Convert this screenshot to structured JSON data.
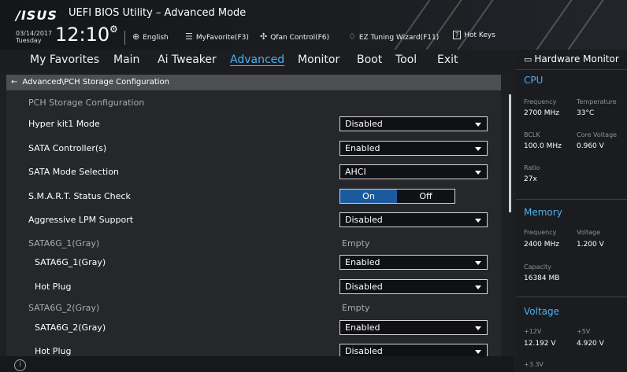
{
  "header": {
    "logo": "/ISUS",
    "title": "UEFI BIOS Utility – Advanced Mode",
    "date": "03/14/2017",
    "day": "Tuesday",
    "time": "12:10",
    "tools": [
      {
        "icon": "globe-icon",
        "label": "English"
      },
      {
        "icon": "favorite-icon",
        "label": "MyFavorite(F3)"
      },
      {
        "icon": "fan-icon",
        "label": "Qfan Control(F6)"
      },
      {
        "icon": "bulb-icon",
        "label": "EZ Tuning Wizard(F11)"
      },
      {
        "icon": "hotkeys-icon",
        "label": "Hot Keys"
      }
    ]
  },
  "nav": {
    "tabs": [
      "My Favorites",
      "Main",
      "Ai Tweaker",
      "Advanced",
      "Monitor",
      "Boot",
      "Tool",
      "Exit"
    ],
    "active": "Advanced"
  },
  "breadcrumb": "Advanced\\PCH Storage Configuration",
  "main": {
    "section_title": "PCH Storage Configuration",
    "rows": [
      {
        "label": "Hyper kit1 Mode",
        "value": "Disabled"
      },
      {
        "label": "SATA Controller(s)",
        "value": "Enabled"
      },
      {
        "label": "SATA Mode Selection",
        "value": "AHCI"
      },
      {
        "label": "S.M.A.R.T. Status Check",
        "on": "On",
        "off": "Off"
      },
      {
        "label": "Aggressive LPM Support",
        "value": "Disabled"
      },
      {
        "label": "SATA6G_1(Gray)",
        "value": "Empty"
      },
      {
        "label": "SATA6G_1(Gray)",
        "value": "Enabled"
      },
      {
        "label": "Hot Plug",
        "value": "Disabled"
      },
      {
        "label": "SATA6G_2(Gray)",
        "value": "Empty"
      },
      {
        "label": "SATA6G_2(Gray)",
        "value": "Enabled"
      },
      {
        "label": "Hot Plug",
        "value": "Disabled"
      }
    ]
  },
  "hw_monitor": {
    "title": "Hardware Monitor",
    "cpu": {
      "heading": "CPU",
      "frequency_label": "Frequency",
      "frequency": "2700 MHz",
      "temperature_label": "Temperature",
      "temperature": "33°C",
      "bclk_label": "BCLK",
      "bclk": "100.0 MHz",
      "core_voltage_label": "Core Voltage",
      "core_voltage": "0.960 V",
      "ratio_label": "Ratio",
      "ratio": "27x"
    },
    "memory": {
      "heading": "Memory",
      "frequency_label": "Frequency",
      "frequency": "2400 MHz",
      "voltage_label": "Voltage",
      "voltage": "1.200 V",
      "capacity_label": "Capacity",
      "capacity": "16384 MB"
    },
    "voltage": {
      "heading": "Voltage",
      "v12_label": "+12V",
      "v12": "12.192 V",
      "v5_label": "+5V",
      "v5": "4.920 V",
      "v33_label": "+3.3V"
    }
  },
  "colors": {
    "accent": "#4fb0f0",
    "toggle_on": "#1c5aa0"
  }
}
